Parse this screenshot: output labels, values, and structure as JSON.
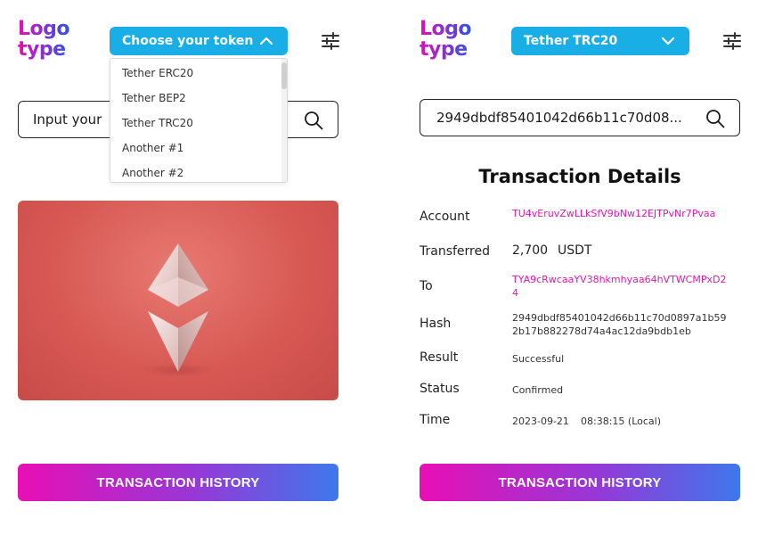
{
  "left": {
    "logo": {
      "line1": "Logo",
      "line2": "type"
    },
    "token_select": {
      "label": "Choose your token",
      "expanded": true
    },
    "dropdown_options": [
      "Tether ERC20",
      "Tether BEP2",
      "Tether TRC20",
      "Another #1",
      "Another #2"
    ],
    "search": {
      "placeholder": "Input your"
    },
    "history_button": "TRANSACTION HISTORY"
  },
  "right": {
    "logo": {
      "line1": "Logo",
      "line2": "type"
    },
    "token_select": {
      "label": "Tether TRC20",
      "expanded": false
    },
    "search": {
      "value": "2949dbdf85401042d66b11c70d08..."
    },
    "details": {
      "title": "Transaction Details",
      "account_label": "Account",
      "account_value": "TU4vEruvZwLLkSfV9bNw12EJTPvNr7Pvaa",
      "transferred_label": "Transferred",
      "transferred_amount": "2,700",
      "transferred_unit": "USDT",
      "to_label": "To",
      "to_value": "TYA9cRwcaaYV38hkmhyaa64hVTWCMPxD24",
      "hash_label": "Hash",
      "hash_value": "2949dbdf85401042d66b11c70d0897a1b592b17b882278d74a4ac12da9bdb1eb",
      "result_label": "Result",
      "result_value": "Successful",
      "status_label": "Status",
      "status_value": "Confirmed",
      "time_label": "Time",
      "time_date": "2023-09-21",
      "time_clock": "08:38:15 (Local)"
    },
    "history_button": "TRANSACTION HISTORY"
  },
  "colors": {
    "brand_blue": "#19aee6",
    "pink": "#e018b0",
    "gradient_start": "#e80fb5",
    "gradient_end": "#3e78ec"
  },
  "icons": [
    "chevron-up-icon",
    "chevron-down-icon",
    "filter-sliders-icon",
    "search-icon",
    "ethereum-logo"
  ]
}
